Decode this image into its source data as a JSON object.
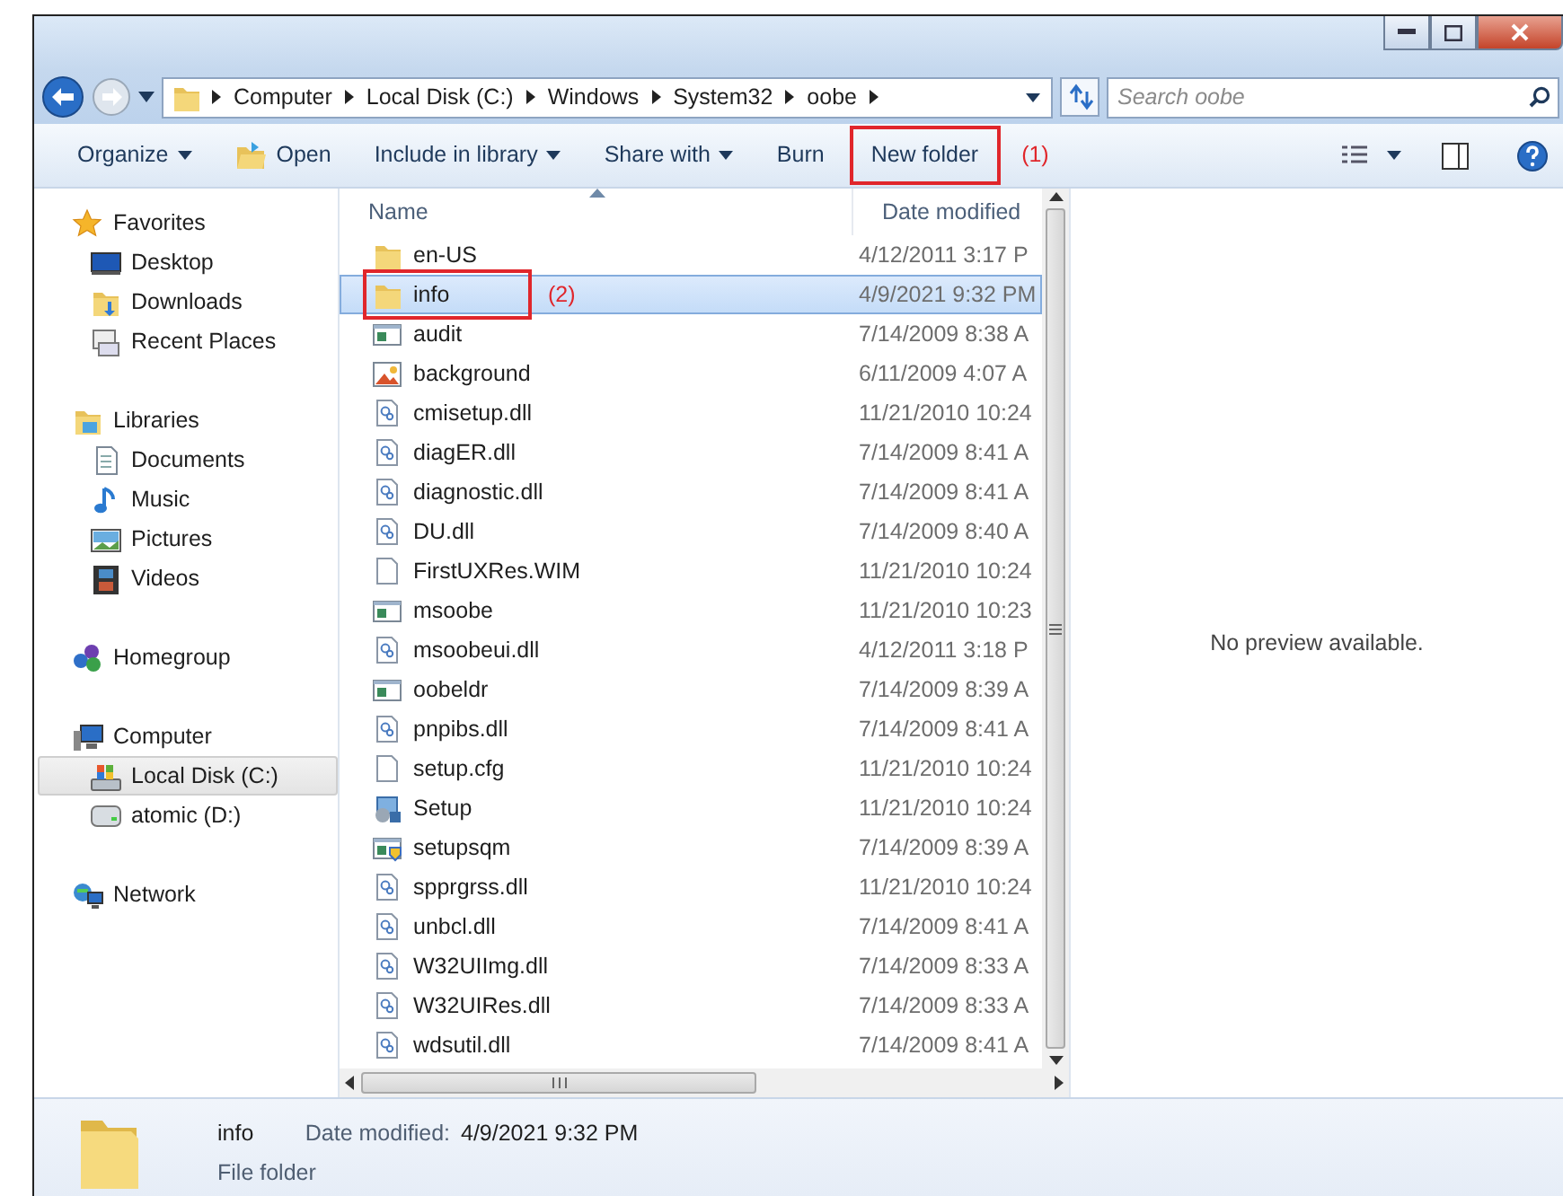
{
  "address_bar": {
    "path": [
      "Computer",
      "Local Disk (C:)",
      "Windows",
      "System32",
      "oobe"
    ]
  },
  "search": {
    "placeholder": "Search oobe"
  },
  "toolbar": {
    "items": [
      {
        "label": "Organize",
        "kind": "menu",
        "highlighted": false
      },
      {
        "label": "Open",
        "kind": "open",
        "highlighted": false
      },
      {
        "label": "Include in library",
        "kind": "menu",
        "highlighted": false
      },
      {
        "label": "Share with",
        "kind": "menu",
        "highlighted": false
      },
      {
        "label": "Burn",
        "kind": "command",
        "highlighted": false
      },
      {
        "label": "New folder",
        "kind": "command",
        "highlighted": true,
        "annotation": "(1)"
      }
    ]
  },
  "nav": [
    {
      "label": "Favorites",
      "kind": "star",
      "selected": false,
      "children": [
        {
          "label": "Desktop",
          "kind": "desktop",
          "selected": false
        },
        {
          "label": "Downloads",
          "kind": "downloads",
          "selected": false
        },
        {
          "label": "Recent Places",
          "kind": "recent",
          "selected": false
        }
      ]
    },
    {
      "label": "Libraries",
      "kind": "library",
      "selected": false,
      "children": [
        {
          "label": "Documents",
          "kind": "document",
          "selected": false
        },
        {
          "label": "Music",
          "kind": "music",
          "selected": false
        },
        {
          "label": "Pictures",
          "kind": "pictures",
          "selected": false
        },
        {
          "label": "Videos",
          "kind": "videos",
          "selected": false
        }
      ]
    },
    {
      "label": "Homegroup",
      "kind": "homegroup",
      "selected": false
    },
    {
      "label": "Computer",
      "kind": "computer",
      "selected": false,
      "children": [
        {
          "label": "Local Disk (C:)",
          "kind": "disk",
          "selected": true
        },
        {
          "label": "atomic (D:)",
          "kind": "drive",
          "selected": false
        }
      ]
    },
    {
      "label": "Network",
      "kind": "network",
      "selected": false
    }
  ],
  "columns": [
    {
      "label": "Name",
      "sorted": true
    },
    {
      "label": "Date modified",
      "sorted": false
    }
  ],
  "files": [
    {
      "name": "en-US",
      "date": "4/12/2011 3:17 P",
      "kind": "folder",
      "selected": false,
      "highlighted": false
    },
    {
      "name": "info",
      "date": "4/9/2021 9:32 PM",
      "kind": "folder",
      "selected": true,
      "highlighted": true,
      "annotation": "(2)"
    },
    {
      "name": "audit",
      "date": "7/14/2009 8:38 A",
      "kind": "exe",
      "selected": false,
      "highlighted": false
    },
    {
      "name": "background",
      "date": "6/11/2009 4:07 A",
      "kind": "image",
      "selected": false,
      "highlighted": false
    },
    {
      "name": "cmisetup.dll",
      "date": "11/21/2010 10:24",
      "kind": "dll",
      "selected": false,
      "highlighted": false
    },
    {
      "name": "diagER.dll",
      "date": "7/14/2009 8:41 A",
      "kind": "dll",
      "selected": false,
      "highlighted": false
    },
    {
      "name": "diagnostic.dll",
      "date": "7/14/2009 8:41 A",
      "kind": "dll",
      "selected": false,
      "highlighted": false
    },
    {
      "name": "DU.dll",
      "date": "7/14/2009 8:40 A",
      "kind": "dll",
      "selected": false,
      "highlighted": false
    },
    {
      "name": "FirstUXRes.WIM",
      "date": "11/21/2010 10:24",
      "kind": "file",
      "selected": false,
      "highlighted": false
    },
    {
      "name": "msoobe",
      "date": "11/21/2010 10:23",
      "kind": "exe",
      "selected": false,
      "highlighted": false
    },
    {
      "name": "msoobeui.dll",
      "date": "4/12/2011 3:18 P",
      "kind": "dll",
      "selected": false,
      "highlighted": false
    },
    {
      "name": "oobeldr",
      "date": "7/14/2009 8:39 A",
      "kind": "exe",
      "selected": false,
      "highlighted": false
    },
    {
      "name": "pnpibs.dll",
      "date": "7/14/2009 8:41 A",
      "kind": "dll",
      "selected": false,
      "highlighted": false
    },
    {
      "name": "setup.cfg",
      "date": "11/21/2010 10:24",
      "kind": "file",
      "selected": false,
      "highlighted": false
    },
    {
      "name": "Setup",
      "date": "11/21/2010 10:24",
      "kind": "setup",
      "selected": false,
      "highlighted": false
    },
    {
      "name": "setupsqm",
      "date": "7/14/2009 8:39 A",
      "kind": "shieldexe",
      "selected": false,
      "highlighted": false
    },
    {
      "name": "spprgrss.dll",
      "date": "11/21/2010 10:24",
      "kind": "dll",
      "selected": false,
      "highlighted": false
    },
    {
      "name": "unbcl.dll",
      "date": "7/14/2009 8:41 A",
      "kind": "dll",
      "selected": false,
      "highlighted": false
    },
    {
      "name": "W32UIImg.dll",
      "date": "7/14/2009 8:33 A",
      "kind": "dll",
      "selected": false,
      "highlighted": false
    },
    {
      "name": "W32UIRes.dll",
      "date": "7/14/2009 8:33 A",
      "kind": "dll",
      "selected": false,
      "highlighted": false
    },
    {
      "name": "wdsutil.dll",
      "date": "7/14/2009 8:41 A",
      "kind": "dll",
      "selected": false,
      "highlighted": false
    }
  ],
  "preview": {
    "message": "No preview available."
  },
  "details": {
    "name": "info",
    "date_label": "Date modified:",
    "date": "4/9/2021 9:32 PM",
    "type": "File folder"
  }
}
